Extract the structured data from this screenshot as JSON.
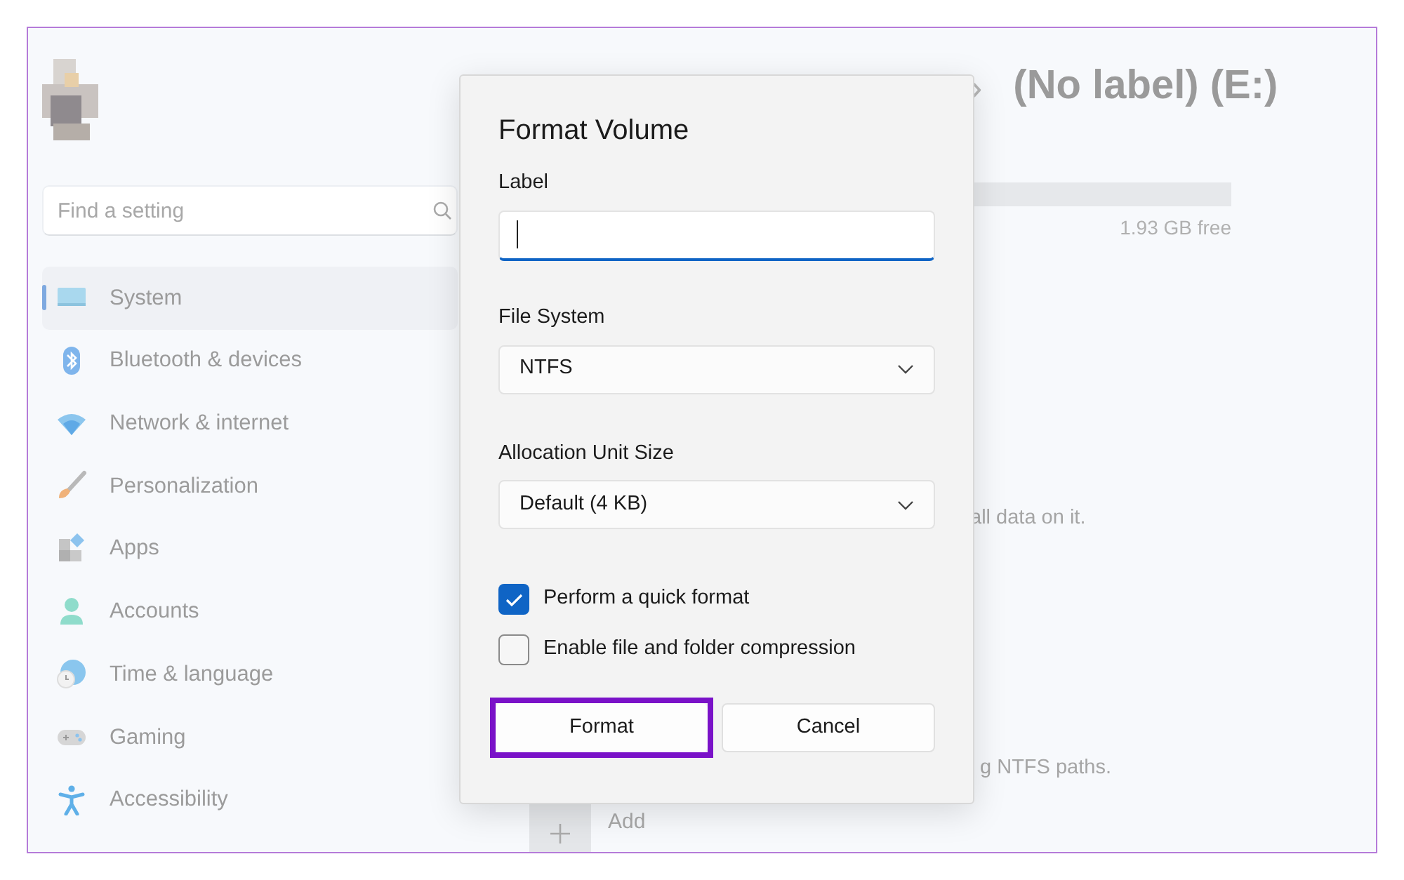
{
  "sidebar": {
    "search": {
      "placeholder": "Find a setting"
    },
    "items": [
      {
        "label": "System",
        "selected": true
      },
      {
        "label": "Bluetooth & devices",
        "selected": false
      },
      {
        "label": "Network & internet",
        "selected": false
      },
      {
        "label": "Personalization",
        "selected": false
      },
      {
        "label": "Apps",
        "selected": false
      },
      {
        "label": "Accounts",
        "selected": false
      },
      {
        "label": "Time & language",
        "selected": false
      },
      {
        "label": "Gaming",
        "selected": false
      },
      {
        "label": "Accessibility",
        "selected": false
      }
    ]
  },
  "page": {
    "breadcrumb_separator": "›",
    "title": "(No label) (E:)",
    "storage_free": "1.93 GB free",
    "text_1": "all data on it.",
    "text_2": "g NTFS paths.",
    "add_button": "Add"
  },
  "dialog": {
    "title": "Format Volume",
    "label_field": {
      "label": "Label"
    },
    "file_system": {
      "label": "File System",
      "value": "NTFS"
    },
    "allocation": {
      "label": "Allocation Unit Size",
      "value": "Default (4 KB)"
    },
    "options": [
      {
        "label": "Perform a quick format",
        "checked": true
      },
      {
        "label": "Enable file and folder compression",
        "checked": false
      }
    ],
    "buttons": [
      {
        "label": "Format",
        "highlighted": true
      },
      {
        "label": "Cancel",
        "highlighted": false
      }
    ]
  }
}
